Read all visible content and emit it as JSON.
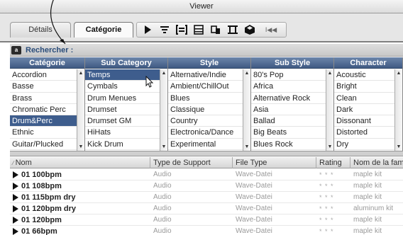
{
  "window": {
    "title": "Viewer"
  },
  "tabs": [
    {
      "label": "Détails",
      "active": false
    },
    {
      "label": "Catégorie",
      "active": true
    }
  ],
  "toolbar": {
    "icons": [
      "play-icon",
      "filter-lines-icon",
      "bracket-list-icon",
      "list-icon",
      "split-view-icon",
      "columns-icon",
      "cube-icon",
      "skip-back-icon"
    ],
    "skip_label": "I◀◀"
  },
  "search": {
    "icon_text": "a",
    "label": "Rechercher :"
  },
  "columns": [
    {
      "header": "Catégorie",
      "items": [
        "Accordion",
        "Basse",
        "Brass",
        "Chromatic Perc",
        "Drum&Perc",
        "Ethnic",
        "Guitar/Plucked"
      ],
      "selected": 4
    },
    {
      "header": "Sub Category",
      "items": [
        "Temps",
        "Cymbals",
        "Drum Menues",
        "Drumset",
        "Drumset GM",
        "HiHats",
        "Kick Drum"
      ],
      "selected": 0
    },
    {
      "header": "Style",
      "items": [
        "Alternative/Indie",
        "Ambient/ChillOut",
        "Blues",
        "Classique",
        "Country",
        "Electronica/Dance",
        "Experimental"
      ],
      "selected": -1
    },
    {
      "header": "Sub Style",
      "items": [
        "80's Pop",
        "Africa",
        "Alternative Rock",
        "Asia",
        "Ballad",
        "Big Beats",
        "Blues Rock"
      ],
      "selected": -1
    },
    {
      "header": "Character",
      "items": [
        "Acoustic",
        "Bright",
        "Clean",
        "Dark",
        "Dissonant",
        "Distorted",
        "Dry"
      ],
      "selected": -1
    }
  ],
  "results": {
    "headers": [
      "Nom",
      "Type de Support",
      "File Type",
      "Rating",
      "Nom de la fami"
    ],
    "rows": [
      {
        "name": "01 100bpm",
        "type": "Audio",
        "file": "Wave-Datei",
        "rating": "* * *",
        "family": "maple kit"
      },
      {
        "name": "01 108bpm",
        "type": "Audio",
        "file": "Wave-Datei",
        "rating": "* * *",
        "family": "maple kit"
      },
      {
        "name": "01 115bpm dry",
        "type": "Audio",
        "file": "Wave-Datei",
        "rating": "* * *",
        "family": "maple kit"
      },
      {
        "name": "01 120bpm dry",
        "type": "Audio",
        "file": "Wave-Datei",
        "rating": "* * *",
        "family": "aluminum kit"
      },
      {
        "name": "01 120bpm",
        "type": "Audio",
        "file": "Wave-Datei",
        "rating": "* * *",
        "family": "maple kit"
      },
      {
        "name": "01 66bpm",
        "type": "Audio",
        "file": "Wave-Datei",
        "rating": "* * *",
        "family": "maple kit"
      }
    ]
  },
  "colors": {
    "header_blue": "#4a6590",
    "selection": "#3e5d8d"
  }
}
